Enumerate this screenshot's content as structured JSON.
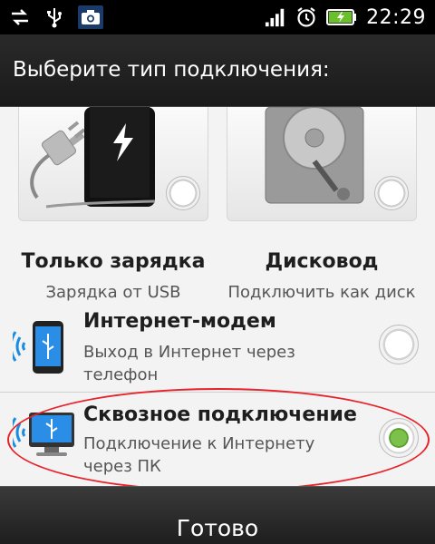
{
  "status_bar": {
    "time": "22:29",
    "left_icons": [
      "sync-arrows-icon",
      "usb-icon",
      "camera-icon"
    ],
    "right_icons": [
      "signal-icon",
      "alarm-icon",
      "battery-charging-icon"
    ]
  },
  "dialog": {
    "title": "Выберите тип подключения:"
  },
  "options": {
    "charge_only": {
      "title": "Только зарядка",
      "subtitle": "Зарядка от USB",
      "selected": false
    },
    "disk_drive": {
      "title": "Дисковод",
      "subtitle": "Подключить как диск",
      "selected": false
    },
    "internet_modem": {
      "title": "Интернет-модем",
      "subtitle": "Выход в Интернет через телефон",
      "selected": false
    },
    "passthrough": {
      "title": "Сквозное подключение",
      "subtitle": "Подключение к Интернету через ПК",
      "selected": true
    }
  },
  "footer": {
    "done_label": "Готово"
  },
  "colors": {
    "selected_radio": "#7cc14a",
    "highlight_ellipse": "#e8222a"
  }
}
